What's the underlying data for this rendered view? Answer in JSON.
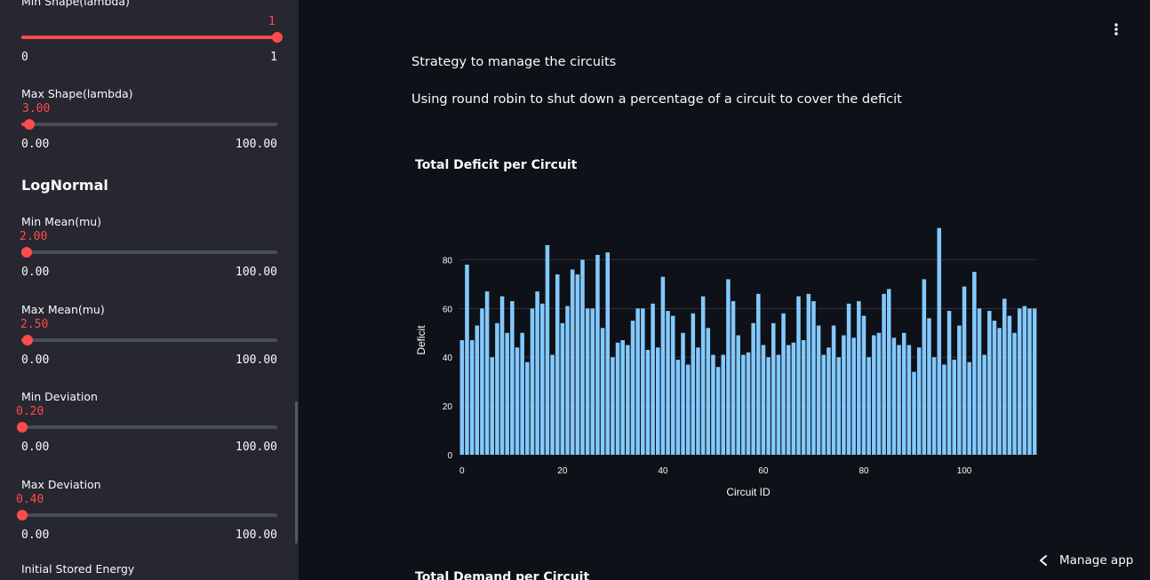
{
  "sidebar": {
    "sliders": [
      {
        "label": "Min Shape(lambda)",
        "value": "1",
        "min": "0",
        "max": "1",
        "fraction": 1.0,
        "compact": true
      },
      {
        "label": "Max Shape(lambda)",
        "value": "3.00",
        "min": "0.00",
        "max": "100.00",
        "fraction": 0.03
      },
      {
        "label": "Min Mean(mu)",
        "value": "2.00",
        "min": "0.00",
        "max": "100.00",
        "fraction": 0.02
      },
      {
        "label": "Max Mean(mu)",
        "value": "2.50",
        "min": "0.00",
        "max": "100.00",
        "fraction": 0.025
      },
      {
        "label": "Min Deviation",
        "value": "0.20",
        "min": "0.00",
        "max": "100.00",
        "fraction": 0.002
      },
      {
        "label": "Max Deviation",
        "value": "0.40",
        "min": "0.00",
        "max": "100.00",
        "fraction": 0.004
      }
    ],
    "section_lognormal": "LogNormal",
    "next_label": "Initial Stored Energy"
  },
  "main": {
    "para1": "Strategy to manage the circuits",
    "para2": "Using round robin to shut down a percentage of a circuit to cover the deficit",
    "chart2_title": "Total Demand per Circuit",
    "menu_icon": "kebab-menu-icon",
    "manage_label": "Manage app",
    "manage_icon": "chevron-left-icon"
  },
  "colors": {
    "accent": "#ff4b4b",
    "bar": "#83c9ff",
    "sidebar_bg": "#262730",
    "main_bg": "#0e1117"
  },
  "chart_data": {
    "type": "bar",
    "title": "Total Deficit per Circuit",
    "xlabel": "Circuit ID",
    "ylabel": "Deficit",
    "xlim": [
      -0.5,
      114.5
    ],
    "ylim": [
      0,
      94
    ],
    "xticks": [
      0,
      20,
      40,
      60,
      80,
      100
    ],
    "yticks": [
      0,
      20,
      40,
      60,
      80
    ],
    "color": "#83c9ff",
    "x_start": 0,
    "values": [
      47,
      78,
      47,
      53,
      60,
      67,
      40,
      54,
      65,
      50,
      63,
      44,
      50,
      38,
      60,
      67,
      62,
      86,
      41,
      74,
      54,
      61,
      76,
      74,
      80,
      60,
      60,
      82,
      52,
      83,
      40,
      46,
      47,
      45,
      55,
      60,
      60,
      43,
      62,
      44,
      73,
      59,
      57,
      39,
      50,
      37,
      58,
      44,
      65,
      52,
      41,
      36,
      41,
      72,
      63,
      49,
      41,
      42,
      54,
      66,
      45,
      40,
      54,
      41,
      58,
      45,
      46,
      65,
      47,
      66,
      63,
      53,
      41,
      44,
      53,
      40,
      49,
      62,
      48,
      63,
      57,
      40,
      49,
      50,
      66,
      68,
      48,
      45,
      50,
      45,
      34,
      44,
      72,
      56,
      40,
      93,
      37,
      59,
      39,
      53,
      69,
      38,
      75,
      60,
      41,
      59,
      55,
      52,
      64,
      57,
      50,
      60,
      61,
      60,
      60
    ]
  }
}
